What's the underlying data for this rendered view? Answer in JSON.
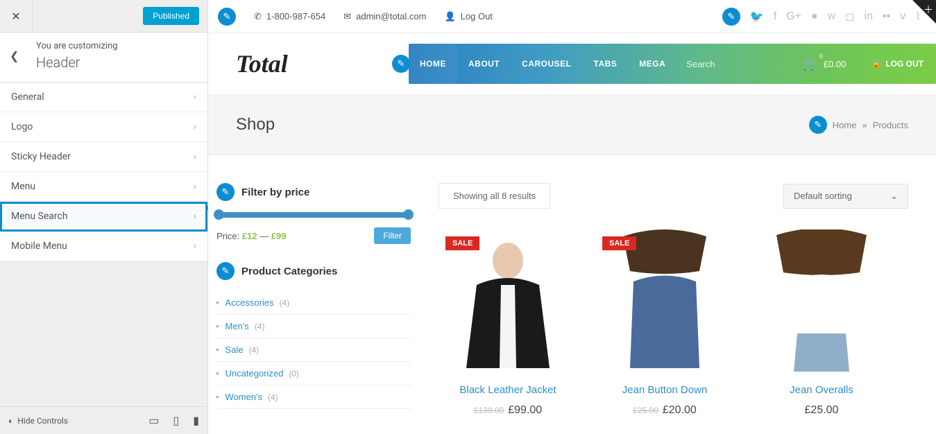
{
  "customizer": {
    "publish_label": "Published",
    "you_are": "You are customizing",
    "section": "Header",
    "items": [
      "General",
      "Logo",
      "Sticky Header",
      "Menu",
      "Menu Search",
      "Mobile Menu"
    ],
    "highlight_index": 4,
    "hide_controls": "Hide Controls"
  },
  "topbar": {
    "phone": "1-800-987-654",
    "email": "admin@total.com",
    "logout": "Log Out"
  },
  "header": {
    "logo": "Total",
    "menu": [
      "HOME",
      "ABOUT",
      "CAROUSEL",
      "TABS",
      "MEGA"
    ],
    "search_placeholder": "Search",
    "cart_count": "0",
    "cart_total": "£0.00",
    "logout": "LOG OUT",
    "mini_cart_badge": "0"
  },
  "titlebar": {
    "title": "Shop",
    "crumb_home": "Home",
    "crumb_sep": "»",
    "crumb_current": "Products"
  },
  "filter": {
    "heading": "Filter by price",
    "label": "Price:",
    "min": "£12",
    "dash": "—",
    "max": "£99",
    "button": "Filter"
  },
  "categories": {
    "heading": "Product Categories",
    "items": [
      {
        "name": "Accessories",
        "count": "(4)"
      },
      {
        "name": "Men's",
        "count": "(4)"
      },
      {
        "name": "Sale",
        "count": "(4)"
      },
      {
        "name": "Uncategorized",
        "count": "(0)"
      },
      {
        "name": "Women's",
        "count": "(4)"
      }
    ]
  },
  "shop": {
    "showing": "Showing all 8 results",
    "sort": "Default sorting",
    "products": [
      {
        "name": "Black Leather Jacket",
        "sale": "SALE",
        "old": "£139.00",
        "price": "£99.00"
      },
      {
        "name": "Jean Button Down",
        "sale": "SALE",
        "old": "£25.00",
        "price": "£20.00"
      },
      {
        "name": "Jean Overalls",
        "sale": "",
        "old": "",
        "price": "£25.00"
      }
    ]
  }
}
